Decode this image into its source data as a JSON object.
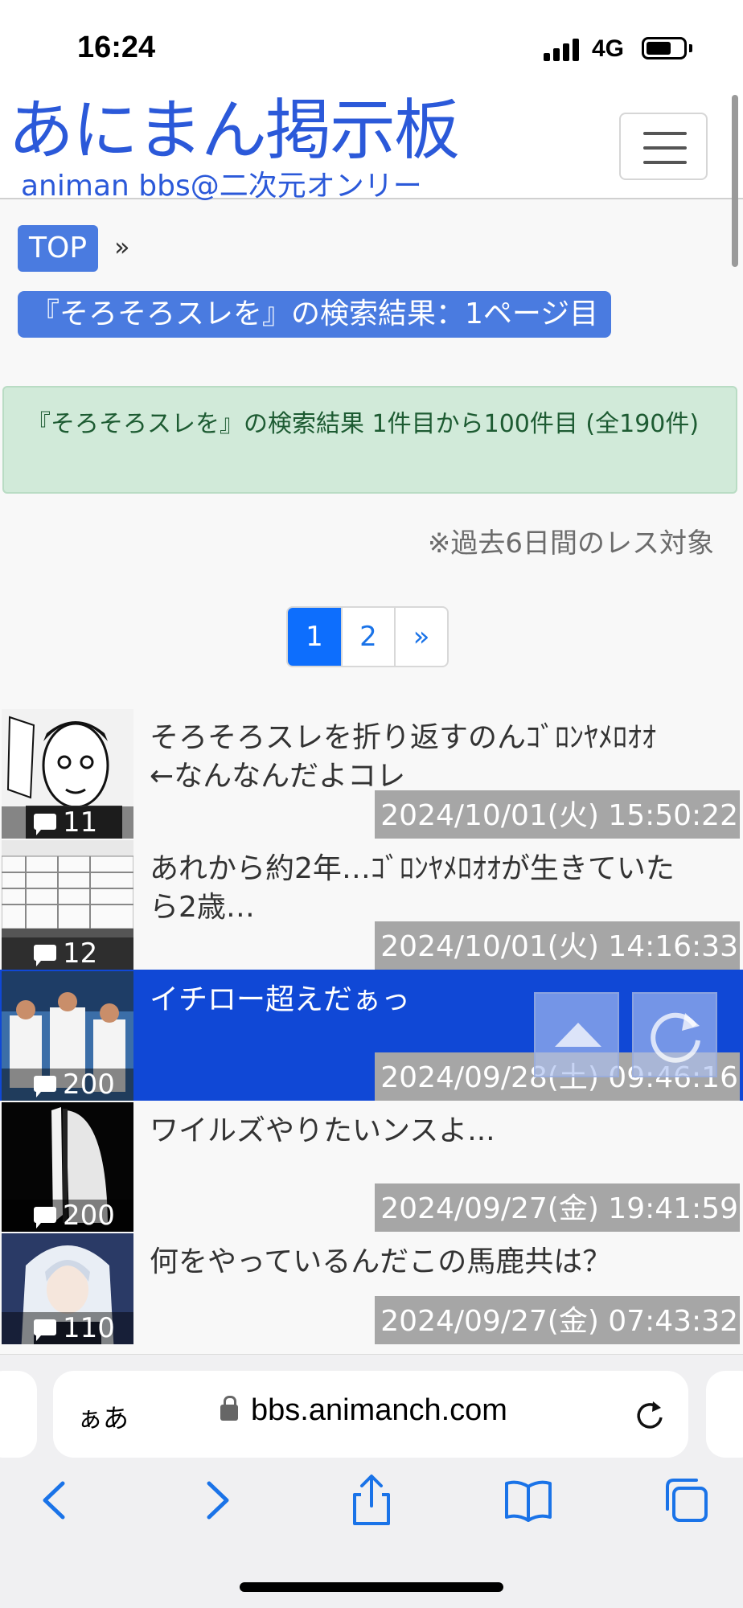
{
  "status_bar": {
    "time": "16:24",
    "network": "4G"
  },
  "header": {
    "logo_main": "あにまん掲示板",
    "logo_sub": "animan bbs@二次元オンリー",
    "menu_icon": "hamburger-icon"
  },
  "breadcrumb": {
    "top": "TOP",
    "separator": "»"
  },
  "page_heading": "『そろそろスレを』の検索結果：1ページ目",
  "result_summary": "『そろそろスレを』の検索結果 1件目から100件目 (全190件)",
  "note": "※過去6日間のレス対象",
  "pagination": {
    "pages": [
      "1",
      "2"
    ],
    "next": "»",
    "current": "1"
  },
  "threads": [
    {
      "title": "そろそろスレを折り返すのんｺﾞﾛﾝﾔﾒﾛｵｵ←なんなんだよコレ",
      "count": "11",
      "timestamp": "2024/10/01(火) 15:50:22"
    },
    {
      "title": "あれから約2年…ｺﾞﾛﾝﾔﾒﾛｵｵが生きていたら2歳…",
      "count": "12",
      "timestamp": "2024/10/01(火) 14:16:33"
    },
    {
      "title": "イチロー超えだぁっ",
      "count": "200",
      "timestamp": "2024/09/28(土) 09:46:16"
    },
    {
      "title": "ワイルズやりたいンスよ...",
      "count": "200",
      "timestamp": "2024/09/27(金) 19:41:59"
    },
    {
      "title": "何をやっているんだこの馬鹿共は？",
      "count": "110",
      "timestamp": "2024/09/27(金) 07:43:32"
    }
  ],
  "safari": {
    "aa_label": "ぁあ",
    "url": "bbs.animanch.com"
  },
  "colors": {
    "brand": "#2b59d9",
    "active_row": "#1048d6",
    "pagination_active": "#0d6efd",
    "ios_blue": "#1a73e8"
  }
}
